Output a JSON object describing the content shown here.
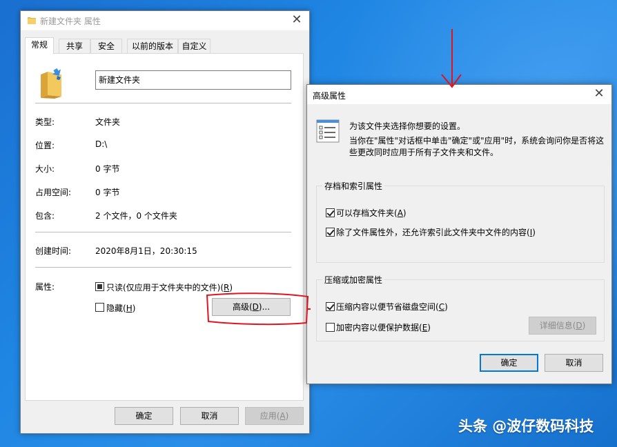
{
  "properties_window": {
    "title": "新建文件夹 属性",
    "tabs": [
      "常规",
      "共享",
      "安全",
      "以前的版本",
      "自定义"
    ],
    "folder_name": "新建文件夹",
    "fields": {
      "type_label": "类型:",
      "type_value": "文件夹",
      "location_label": "位置:",
      "location_value": "D:\\",
      "size_label": "大小:",
      "size_value": "0 字节",
      "disk_size_label": "占用空间:",
      "disk_size_value": "0 字节",
      "contains_label": "包含:",
      "contains_value": "2 个文件，0 个文件夹",
      "created_label": "创建时间:",
      "created_value": "2020年8月1日，20:30:15",
      "attributes_label": "属性:"
    },
    "readonly": {
      "prefix": "只读(仅应用于文件夹中的文件)(",
      "key": "R",
      "suffix": ")"
    },
    "hidden": {
      "prefix": "隐藏(",
      "key": "H",
      "suffix": ")"
    },
    "advanced_button": {
      "prefix": "高级(",
      "key": "D",
      "suffix": ")..."
    },
    "buttons": {
      "ok": "确定",
      "cancel": "取消",
      "apply_prefix": "应用(",
      "apply_key": "A",
      "apply_suffix": ")"
    }
  },
  "advanced_dialog": {
    "title": "高级属性",
    "intro": "为该文件夹选择你想要的设置。",
    "description": "当你在\"属性\"对话框中单击\"确定\"或\"应用\"时，系统会询问你是否将这些更改同时应用于所有子文件夹和文件。",
    "archive_group": {
      "title": "存档和索引属性",
      "archive": {
        "prefix": "可以存档文件夹(",
        "key": "A",
        "suffix": ")",
        "checked": true
      },
      "index": {
        "prefix": "除了文件属性外，还允许索引此文件夹中文件的内容(",
        "key": "I",
        "suffix": ")",
        "checked": true
      }
    },
    "compress_group": {
      "title": "压缩或加密属性",
      "compress": {
        "prefix": "压缩内容以便节省磁盘空间(",
        "key": "C",
        "suffix": ")",
        "checked": true
      },
      "encrypt": {
        "prefix": "加密内容以便保护数据(",
        "key": "E",
        "suffix": ")",
        "checked": false
      },
      "details": {
        "prefix": "详细信息(",
        "key": "D",
        "suffix": ")"
      }
    },
    "buttons": {
      "ok": "确定",
      "cancel": "取消"
    }
  },
  "watermark": "头条 @波仔数码科技",
  "colors": {
    "desktop": "#1f86e3",
    "annotation": "#e0141e",
    "focus": "#0078d7"
  }
}
